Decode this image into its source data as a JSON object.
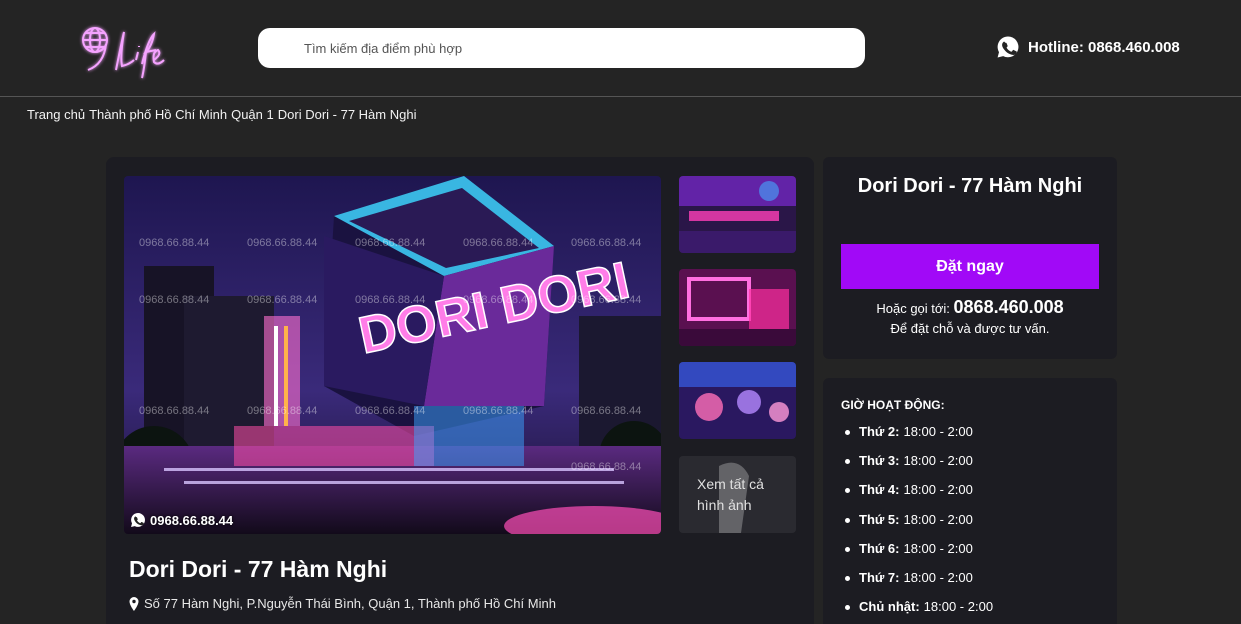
{
  "header": {
    "logo_text": "9Life",
    "search_placeholder": "Tìm kiếm địa điểm phù hợp",
    "hotline_label": "Hotline: 0868.460.008"
  },
  "breadcrumb": [
    "Trang chủ",
    "Thành phố Hồ Chí Minh",
    "Quận 1",
    "Dori Dori - 77 Hàm Nghi"
  ],
  "gallery": {
    "watermark": "0968.66.88.44",
    "hero_phone": "0968.66.88.44",
    "hero_sign_text": "DORI DORI",
    "see_all_label": "Xem tất cả hình ảnh"
  },
  "venue": {
    "title": "Dori Dori - 77 Hàm Nghi",
    "address": "Số 77 Hàm Nghi, P.Nguyễn Thái Bình, Quận 1, Thành phố Hồ Chí Minh"
  },
  "booking": {
    "title": "Dori Dori - 77 Hàm Nghi",
    "button_label": "Đặt ngay",
    "call_prefix": "Hoặc gọi tới: ",
    "call_number": "0868.460.008",
    "advise_text": "Để đặt chỗ và được tư vấn."
  },
  "hours": {
    "title": "GIỜ HOẠT ĐỘNG:",
    "items": [
      {
        "day": "Thứ 2:",
        "time": "18:00 - 2:00"
      },
      {
        "day": "Thứ 3:",
        "time": "18:00 - 2:00"
      },
      {
        "day": "Thứ 4:",
        "time": "18:00 - 2:00"
      },
      {
        "day": "Thứ 5:",
        "time": "18:00 - 2:00"
      },
      {
        "day": "Thứ 6:",
        "time": "18:00 - 2:00"
      },
      {
        "day": "Thứ 7:",
        "time": "18:00 - 2:00"
      },
      {
        "day": "Chủ nhật:",
        "time": "18:00 - 2:00"
      }
    ]
  },
  "colors": {
    "accent": "#a109f7",
    "background": "#242424",
    "card": "#1c1c22"
  }
}
